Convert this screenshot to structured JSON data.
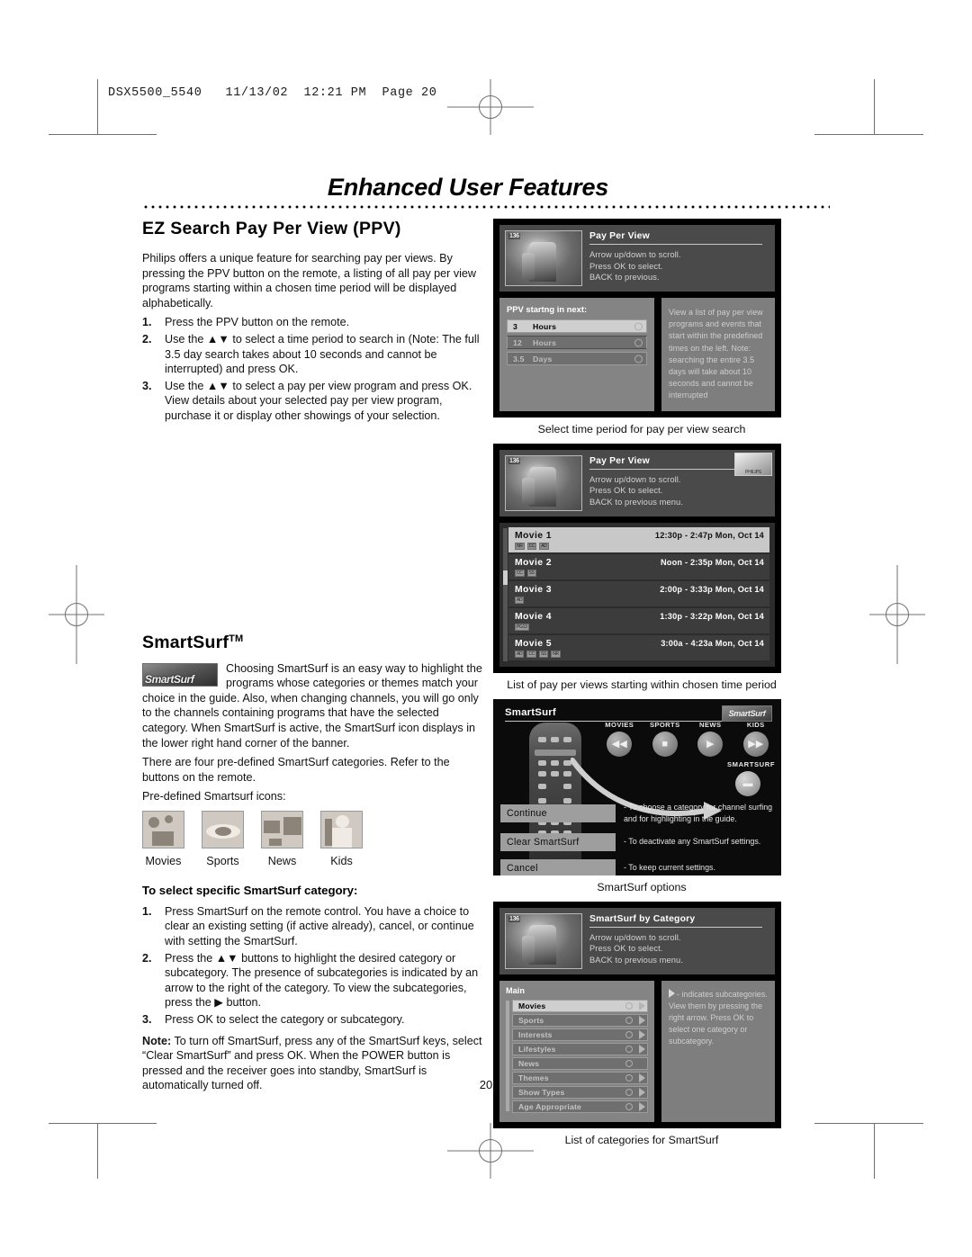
{
  "running_header": "DSX5500_5540   11/13/02  12:21 PM  Page 20",
  "chapter_title": "Enhanced User Features",
  "page_number": "20",
  "left_column": {
    "section1_heading": "EZ Search Pay Per View (PPV)",
    "section1_intro": "Philips offers a unique feature for searching pay per views. By pressing the PPV button on the remote, a listing of all pay per view programs starting within a chosen time period will be displayed alphabetically.",
    "section1_steps": [
      {
        "num": "1.",
        "text": "Press the PPV button on the remote."
      },
      {
        "num": "2.",
        "text": "Use the ▲▼ to select a time period to search in (Note: The full 3.5 day search takes about 10 seconds and cannot be interrupted) and press OK."
      },
      {
        "num": "3.",
        "text": "Use the ▲▼ to select a pay per view program and press OK. View details about your selected pay per view program, purchase it or display other showings of your selection."
      }
    ],
    "section2_heading": "SmartSurf",
    "section2_heading_tm": "TM",
    "section2_logo_text": "SmartSurf",
    "section2_para1": "Choosing SmartSurf is an easy way to highlight the programs whose categories or themes match your choice in the guide. Also, when changing channels, you will go only to the channels containing programs that have the selected category. When SmartSurf is active, the SmartSurf icon displays in the lower right hand corner of the banner.",
    "section2_para2": "There are four pre-defined SmartSurf categories. Refer to the buttons on the remote.",
    "section2_para3": "Pre-defined Smartsurf icons:",
    "predefined_icons": [
      {
        "label": "Movies",
        "icon": "movies-icon"
      },
      {
        "label": "Sports",
        "icon": "sports-icon"
      },
      {
        "label": "News",
        "icon": "news-globe-icon"
      },
      {
        "label": "Kids",
        "icon": "kids-icon"
      }
    ],
    "section3_heading": "To select specific SmartSurf category:",
    "section3_steps": [
      {
        "num": "1.",
        "text": "Press SmartSurf on the remote control. You have a choice to clear an existing setting (if active already), cancel, or continue with setting the SmartSurf."
      },
      {
        "num": "2.",
        "text": "Press the ▲▼ buttons to highlight the desired category or subcategory. The presence of subcategories is indicated by an arrow to the right of the category. To view the subcategories, press the ▶ button."
      },
      {
        "num": "3.",
        "text": "Press OK to select the category or subcategory."
      }
    ],
    "note_label": "Note:",
    "note_text": " To turn off SmartSurf, press any of the SmartSurf keys, select “Clear SmartSurf” and press OK. When the POWER button is pressed and the receiver goes into standby, SmartSurf is automatically turned off."
  },
  "figures": {
    "fig1": {
      "caption": "Select time period for pay per view search",
      "channel": "136",
      "title": "Pay Per View",
      "lines": [
        "Arrow up/down to scroll.",
        "Press OK to select.",
        "BACK to previous."
      ],
      "panel_label": "PPV startng in next:",
      "options": [
        {
          "num": "3",
          "unit": "Hours",
          "selected": true
        },
        {
          "num": "12",
          "unit": "Hours",
          "selected": false
        },
        {
          "num": "3.5",
          "unit": "Days",
          "selected": false
        }
      ],
      "help_text": "View a list of pay per view programs and events that start within the predefined times on the left. Note: searching the entire 3.5 days will take about 10 seconds and cannot be interrupted"
    },
    "fig2": {
      "caption": "List of pay per views starting within chosen time period",
      "channel": "136",
      "title": "Pay Per View",
      "lines": [
        "Arrow up/down to scroll.",
        "Press OK to select.",
        "BACK to previous menu."
      ],
      "logo": "PHILIPS",
      "movies": [
        {
          "name": "Movie 1",
          "time": "12:30p - 2:47p Mon, Oct 14",
          "tags": [
            "NR",
            "CC",
            "AD"
          ],
          "selected": true
        },
        {
          "name": "Movie 2",
          "time": "Noon - 2:35p Mon, Oct 14",
          "tags": [
            "CC",
            "SS"
          ],
          "selected": false
        },
        {
          "name": "Movie 3",
          "time": "2:00p - 3:33p Mon, Oct 14",
          "tags": [
            "AD"
          ],
          "selected": false
        },
        {
          "name": "Movie 4",
          "time": "1:30p - 3:22p Mon, Oct 14",
          "tags": [
            "PG13"
          ],
          "selected": false
        },
        {
          "name": "Movie 5",
          "time": "3:00a - 4:23a Mon, Oct 14",
          "tags": [
            "AD",
            "CC",
            "SS",
            "NR"
          ],
          "selected": false
        }
      ]
    },
    "fig3": {
      "caption": "SmartSurf options",
      "title": "SmartSurf",
      "logo": "SmartSurf",
      "keys": [
        {
          "label": "MOVIES",
          "glyph": "◀◀"
        },
        {
          "label": "SPORTS",
          "glyph": "■"
        },
        {
          "label": "NEWS",
          "glyph": "▶"
        },
        {
          "label": "KIDS",
          "glyph": "▶▶"
        }
      ],
      "smartsurf_key_label": "SMARTSURF",
      "smartsurf_key_glyph": "▬",
      "options": [
        {
          "button": "Continue",
          "desc": "- To choose a category for channel surfing and for highlighting in the guide."
        },
        {
          "button": "Clear SmartSurf",
          "desc": "- To deactivate any SmartSurf settings."
        },
        {
          "button": "Cancel",
          "desc": "- To keep current settings."
        }
      ]
    },
    "fig4": {
      "caption": "List of categories for SmartSurf",
      "channel": "136",
      "title": "SmartSurf by Category",
      "lines": [
        "Arrow up/down to scroll.",
        "Press OK to select.",
        "BACK to previous menu."
      ],
      "panel_label": "Main",
      "categories": [
        {
          "label": "Movies",
          "arrow": true,
          "selected": true
        },
        {
          "label": "Sports",
          "arrow": true,
          "selected": false
        },
        {
          "label": "Interests",
          "arrow": true,
          "selected": false
        },
        {
          "label": "Lifestyles",
          "arrow": true,
          "selected": false
        },
        {
          "label": "News",
          "arrow": false,
          "selected": false
        },
        {
          "label": "Themes",
          "arrow": true,
          "selected": false
        },
        {
          "label": "Show Types",
          "arrow": true,
          "selected": false
        },
        {
          "label": "Age Appropriate",
          "arrow": true,
          "selected": false
        }
      ],
      "help_text": "- indicates subcategories. View them by pressing the right arrow. Press OK to select one category or subcategory."
    }
  }
}
